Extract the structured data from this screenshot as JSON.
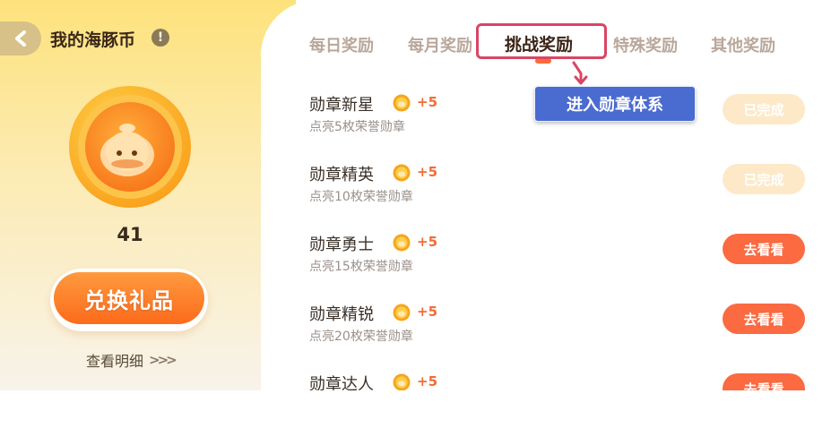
{
  "header": {
    "title": "我的海豚币",
    "back_icon": "chevron-left-icon",
    "info_icon": "info-icon",
    "info_glyph": "!"
  },
  "wallet": {
    "coin_count": "41",
    "exchange_label": "兑换礼品",
    "details_label": "查看明细",
    "details_arrows": ">>>"
  },
  "tabs": [
    {
      "label": "每日奖励",
      "active": false
    },
    {
      "label": "每月奖励",
      "active": false
    },
    {
      "label": "挑战奖励",
      "active": true
    },
    {
      "label": "特殊奖励",
      "active": false
    },
    {
      "label": "其他奖励",
      "active": false
    }
  ],
  "tooltip": {
    "label": "进入勋章体系"
  },
  "tasks": [
    {
      "title": "勋章新星",
      "reward": "+5",
      "desc": "点亮5枚荣誉勋章",
      "button": "已完成",
      "state": "done"
    },
    {
      "title": "勋章精英",
      "reward": "+5",
      "desc": "点亮10枚荣誉勋章",
      "button": "已完成",
      "state": "done"
    },
    {
      "title": "勋章勇士",
      "reward": "+5",
      "desc": "点亮15枚荣誉勋章",
      "button": "去看看",
      "state": "go"
    },
    {
      "title": "勋章精锐",
      "reward": "+5",
      "desc": "点亮20枚荣誉勋章",
      "button": "去看看",
      "state": "go"
    },
    {
      "title": "勋章达人",
      "reward": "+5",
      "desc": "",
      "button": "去看看",
      "state": "go"
    }
  ],
  "colors": {
    "accent": "#fb6a40",
    "highlight": "#d94664",
    "tooltip": "#4a6bcf",
    "done_button": "#fde9c8"
  }
}
